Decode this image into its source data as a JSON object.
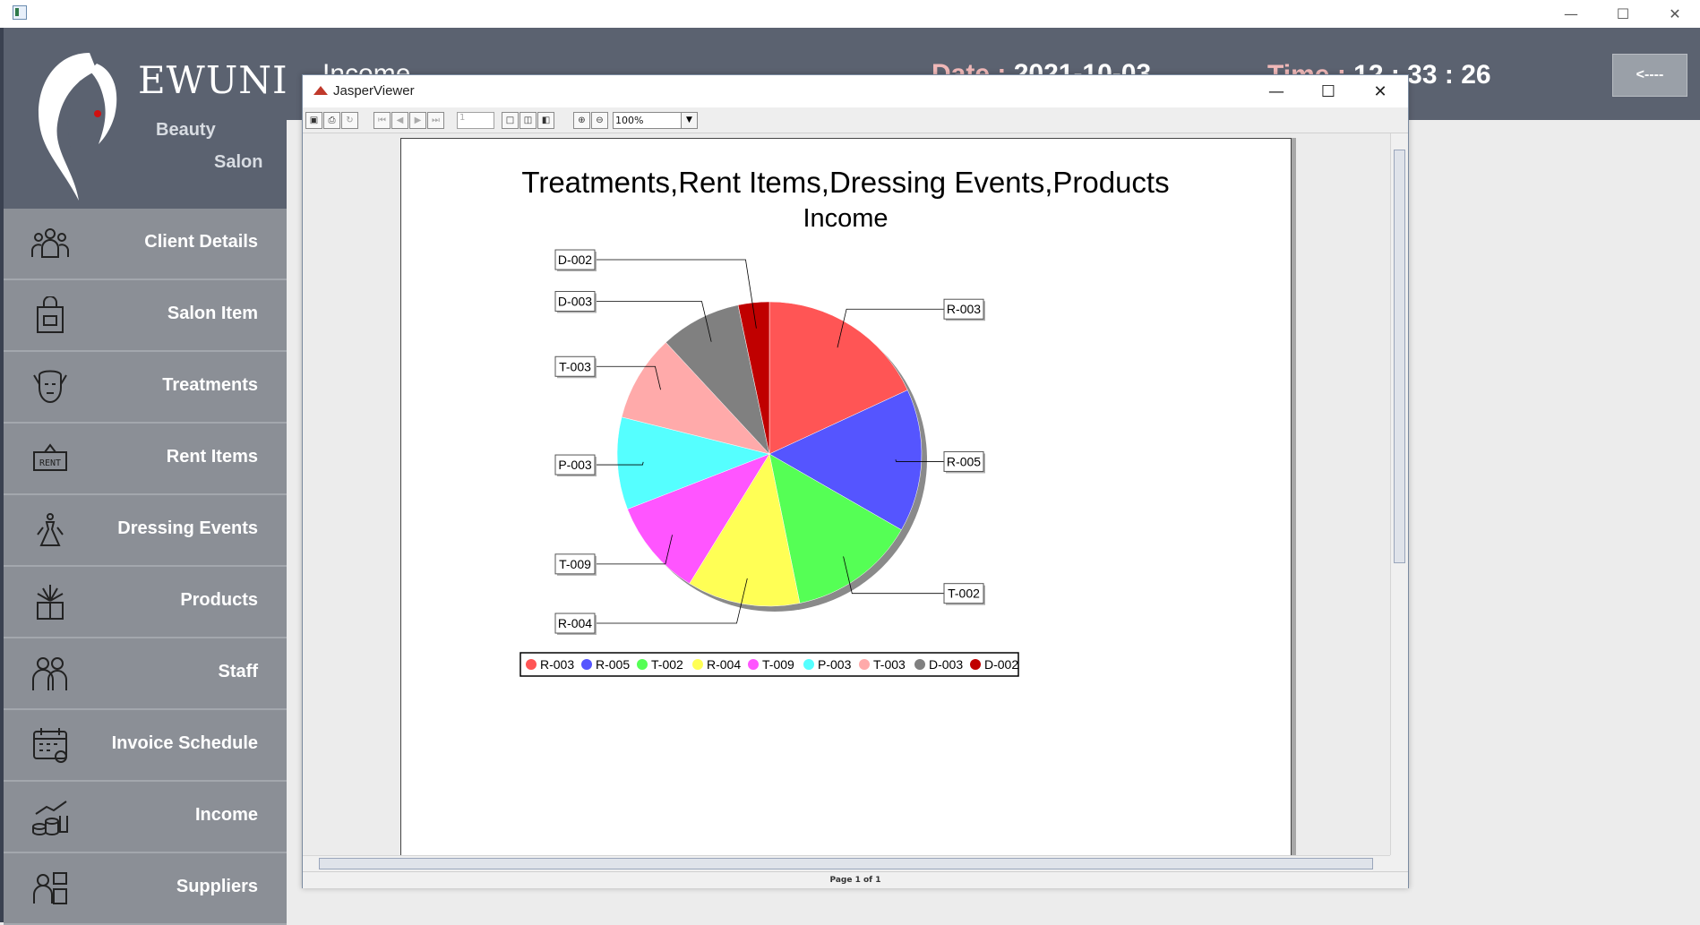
{
  "header": {
    "page_title": "Income",
    "date_label": "Date :",
    "date_value": "2021-10-03",
    "time_label": "Time :",
    "time_value": "12 : 33 : 26",
    "back_label": "<----"
  },
  "brand": {
    "name": "EWUNI",
    "line1": "Beauty",
    "line2": "Salon"
  },
  "sidebar": {
    "items": [
      {
        "label": "Client Details",
        "icon": "people-group-icon"
      },
      {
        "label": "Salon Item",
        "icon": "shopping-bag-icon"
      },
      {
        "label": "Treatments",
        "icon": "face-treatment-icon"
      },
      {
        "label": "Rent Items",
        "icon": "rent-sign-icon"
      },
      {
        "label": "Dressing Events",
        "icon": "dress-icon"
      },
      {
        "label": "Products",
        "icon": "gift-box-icon"
      },
      {
        "label": "Staff",
        "icon": "staff-icon"
      },
      {
        "label": "Invoice Schedule",
        "icon": "calendar-check-icon"
      },
      {
        "label": "Income",
        "icon": "coins-growth-icon"
      },
      {
        "label": "Suppliers",
        "icon": "supplier-icon"
      }
    ]
  },
  "viewer": {
    "window_title": "JasperViewer",
    "zoom": "100%",
    "page_number": "1",
    "status": "Page 1 of 1"
  },
  "chart_data": {
    "type": "pie",
    "title": "Treatments,Rent Items,Dressing Events,Products",
    "subtitle": "Income",
    "categories": [
      "R-003",
      "R-005",
      "T-002",
      "R-004",
      "T-009",
      "P-003",
      "T-003",
      "D-003",
      "D-002"
    ],
    "values": [
      18.1,
      15.2,
      13.5,
      12.0,
      10.3,
      9.8,
      9.2,
      8.6,
      3.3
    ],
    "colors": [
      "#ff5555",
      "#5555ff",
      "#55ff55",
      "#ffff55",
      "#ff55ff",
      "#55ffff",
      "#ffaaaa",
      "#808080",
      "#c00000"
    ],
    "legend": "bottom"
  }
}
